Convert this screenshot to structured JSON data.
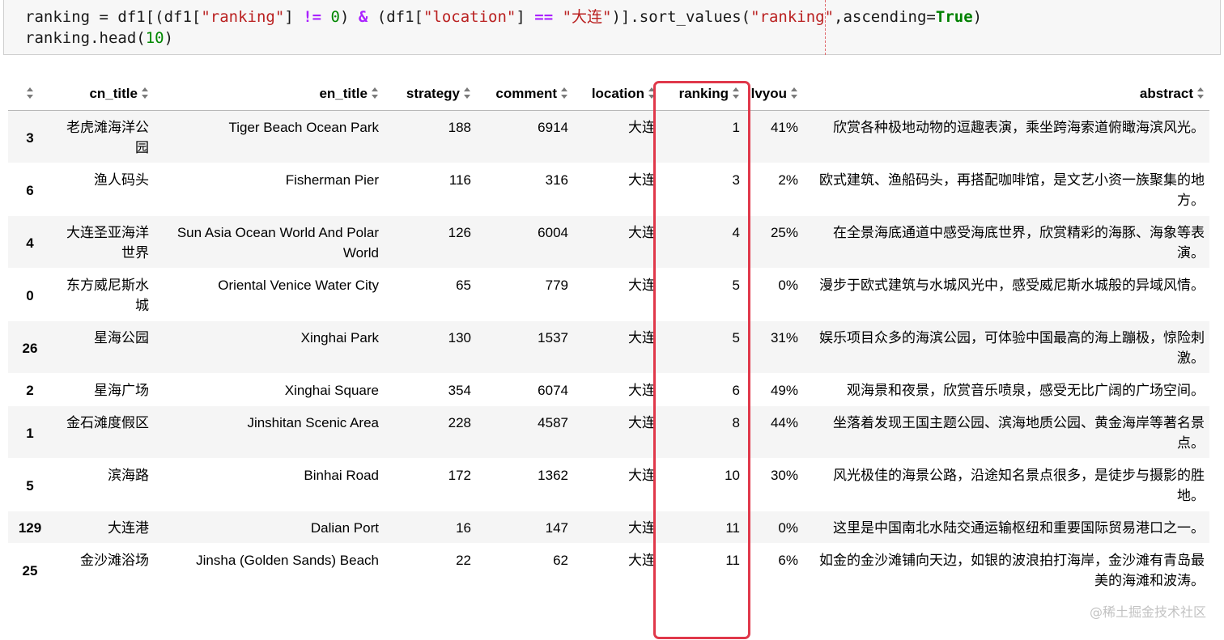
{
  "code": {
    "line1": [
      {
        "t": "ranking = df1[(df1[",
        "c": ""
      },
      {
        "t": "\"ranking\"",
        "c": "str"
      },
      {
        "t": "] ",
        "c": ""
      },
      {
        "t": "!=",
        "c": "op"
      },
      {
        "t": " ",
        "c": ""
      },
      {
        "t": "0",
        "c": "num"
      },
      {
        "t": ") ",
        "c": ""
      },
      {
        "t": "&",
        "c": "op"
      },
      {
        "t": " (df1[",
        "c": ""
      },
      {
        "t": "\"location\"",
        "c": "str"
      },
      {
        "t": "] ",
        "c": ""
      },
      {
        "t": "==",
        "c": "op"
      },
      {
        "t": " ",
        "c": ""
      },
      {
        "t": "\"大连\"",
        "c": "str"
      },
      {
        "t": ")].sort_values(",
        "c": ""
      },
      {
        "t": "\"ranking\"",
        "c": "str"
      },
      {
        "t": ",ascending=",
        "c": ""
      },
      {
        "t": "True",
        "c": "kw"
      },
      {
        "t": ")",
        "c": ""
      }
    ],
    "line2": [
      {
        "t": "ranking.head(",
        "c": ""
      },
      {
        "t": "10",
        "c": "num"
      },
      {
        "t": ")",
        "c": ""
      }
    ]
  },
  "table": {
    "columns": [
      "",
      "cn_title",
      "en_title",
      "strategy",
      "comment",
      "location",
      "ranking",
      "lvyou",
      "abstract"
    ],
    "rows": [
      {
        "idx": "3",
        "cn_title": "老虎滩海洋公园",
        "en_title": "Tiger Beach Ocean Park",
        "strategy": "188",
        "comment": "6914",
        "location": "大连",
        "ranking": "1",
        "lvyou": "41%",
        "abstract": "欣赏各种极地动物的逗趣表演，乘坐跨海索道俯瞰海滨风光。"
      },
      {
        "idx": "6",
        "cn_title": "渔人码头",
        "en_title": "Fisherman Pier",
        "strategy": "116",
        "comment": "316",
        "location": "大连",
        "ranking": "3",
        "lvyou": "2%",
        "abstract": "欧式建筑、渔船码头，再搭配咖啡馆，是文艺小资一族聚集的地方。"
      },
      {
        "idx": "4",
        "cn_title": "大连圣亚海洋世界",
        "en_title": "Sun Asia Ocean World And Polar World",
        "strategy": "126",
        "comment": "6004",
        "location": "大连",
        "ranking": "4",
        "lvyou": "25%",
        "abstract": "在全景海底通道中感受海底世界，欣赏精彩的海豚、海象等表演。"
      },
      {
        "idx": "0",
        "cn_title": "东方威尼斯水城",
        "en_title": "Oriental Venice Water City",
        "strategy": "65",
        "comment": "779",
        "location": "大连",
        "ranking": "5",
        "lvyou": "0%",
        "abstract": "漫步于欧式建筑与水城风光中，感受威尼斯水城般的异域风情。"
      },
      {
        "idx": "26",
        "cn_title": "星海公园",
        "en_title": "Xinghai Park",
        "strategy": "130",
        "comment": "1537",
        "location": "大连",
        "ranking": "5",
        "lvyou": "31%",
        "abstract": "娱乐项目众多的海滨公园，可体验中国最高的海上蹦极，惊险刺激。"
      },
      {
        "idx": "2",
        "cn_title": "星海广场",
        "en_title": "Xinghai Square",
        "strategy": "354",
        "comment": "6074",
        "location": "大连",
        "ranking": "6",
        "lvyou": "49%",
        "abstract": "观海景和夜景，欣赏音乐喷泉，感受无比广阔的广场空间。"
      },
      {
        "idx": "1",
        "cn_title": "金石滩度假区",
        "en_title": "Jinshitan Scenic Area",
        "strategy": "228",
        "comment": "4587",
        "location": "大连",
        "ranking": "8",
        "lvyou": "44%",
        "abstract": "坐落着发现王国主题公园、滨海地质公园、黄金海岸等著名景点。"
      },
      {
        "idx": "5",
        "cn_title": "滨海路",
        "en_title": "Binhai Road",
        "strategy": "172",
        "comment": "1362",
        "location": "大连",
        "ranking": "10",
        "lvyou": "30%",
        "abstract": "风光极佳的海景公路，沿途知名景点很多，是徒步与摄影的胜地。"
      },
      {
        "idx": "129",
        "cn_title": "大连港",
        "en_title": "Dalian Port",
        "strategy": "16",
        "comment": "147",
        "location": "大连",
        "ranking": "11",
        "lvyou": "0%",
        "abstract": "这里是中国南北水陆交通运输枢纽和重要国际贸易港口之一。"
      },
      {
        "idx": "25",
        "cn_title": "金沙滩浴场",
        "en_title": "Jinsha (Golden Sands) Beach",
        "strategy": "22",
        "comment": "62",
        "location": "大连",
        "ranking": "11",
        "lvyou": "6%",
        "abstract": "如金的金沙滩铺向天边，如银的波浪拍打海岸，金沙滩有青岛最美的海滩和波涛。"
      }
    ]
  },
  "colors": {
    "highlight_box": "#e0384a",
    "string": "#ba2121",
    "operator": "#aa22ff",
    "number": "#008800",
    "keyword": "#008000"
  },
  "watermark": "@稀土掘金技术社区"
}
